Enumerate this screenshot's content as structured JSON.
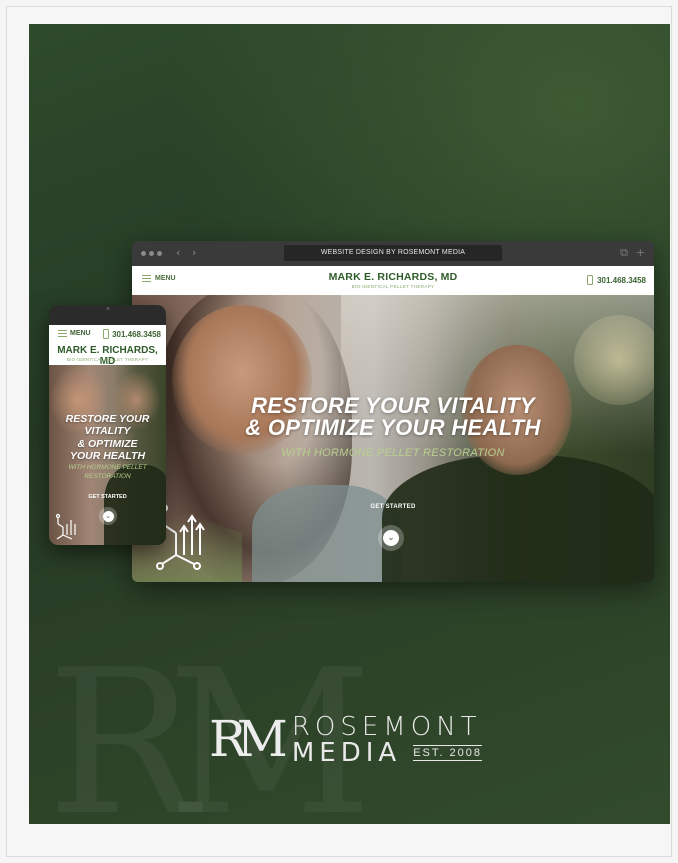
{
  "browser": {
    "url_label": "WEBSITE DESIGN BY ROSEMONT MEDIA"
  },
  "site": {
    "menu_label": "MENU",
    "brand_name": "MARK E. RICHARDS, MD",
    "brand_tagline": "BIO-IDENTICAL PELLET THERAPY",
    "phone": "301.468.3458"
  },
  "hero": {
    "headline_line1": "RESTORE YOUR VITALITY",
    "headline_line2": "& OPTIMIZE YOUR HEALTH",
    "subheadline": "WITH HORMONE PELLET RESTORATION",
    "cta_label": "GET STARTED"
  },
  "mobile": {
    "menu_label": "MENU",
    "phone": "301.468.3458",
    "brand_name": "MARK E. RICHARDS, MD",
    "brand_tagline": "BIO-IDENTICAL PELLET THERAPY",
    "headline_line1": "RESTORE YOUR",
    "headline_line2": "VITALITY",
    "headline_line3": "& OPTIMIZE",
    "headline_line4": "YOUR HEALTH",
    "sub_line1": "WITH HORMONE PELLET",
    "sub_line2": "RESTORATION",
    "cta_label": "GET STARTED"
  },
  "logo": {
    "monogram": "RM",
    "line1": "ROSEMONT",
    "line2": "MEDIA",
    "est": "EST. 2008"
  },
  "watermark": {
    "text": "RM"
  },
  "colors": {
    "brand_green": "#2f5b2a",
    "accent_green": "#8aa86e",
    "subheadline_green": "#b8d08e"
  }
}
